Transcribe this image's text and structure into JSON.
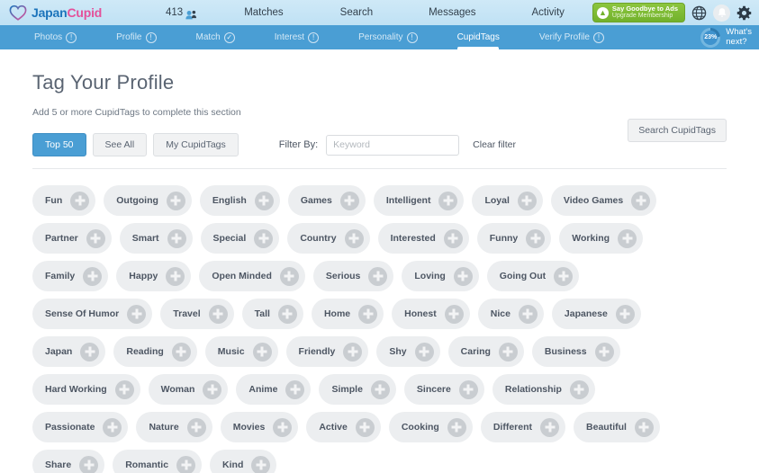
{
  "header": {
    "logo": {
      "part1": "Japan",
      "part2": "Cupid",
      "icon": "heart-icon"
    },
    "visitor_count": "413",
    "nav": [
      {
        "label": "Matches"
      },
      {
        "label": "Search"
      },
      {
        "label": "Messages"
      },
      {
        "label": "Activity"
      }
    ],
    "upgrade": {
      "line1": "Say Goodbye to Ads",
      "line2": "Upgrade Membership",
      "icon": "arrow-up-circle-icon",
      "color": "#8cc63f"
    },
    "icons": {
      "globe": "globe-icon",
      "bell": "bell-icon",
      "gear": "gear-icon"
    }
  },
  "subnav": {
    "items": [
      {
        "label": "Photos",
        "badge": "!",
        "active": false
      },
      {
        "label": "Profile",
        "badge": "!",
        "active": false
      },
      {
        "label": "Match",
        "badge": "✓",
        "active": false
      },
      {
        "label": "Interest",
        "badge": "!",
        "active": false
      },
      {
        "label": "Personality",
        "badge": "!",
        "active": false
      },
      {
        "label": "CupidTags",
        "badge": "",
        "active": true
      },
      {
        "label": "Verify Profile",
        "badge": "!",
        "active": false
      }
    ],
    "progress": {
      "value": "23%",
      "label_line1": "What's",
      "label_line2": "next?"
    },
    "accent": "#4a9ed4"
  },
  "main": {
    "title": "Tag Your Profile",
    "subtitle": "Add 5 or more CupidTags to complete this section",
    "search_button": "Search CupidTags",
    "tabs": [
      {
        "label": "Top 50",
        "active": true
      },
      {
        "label": "See All",
        "active": false
      },
      {
        "label": "My CupidTags",
        "active": false
      }
    ],
    "filter_label": "Filter By:",
    "filter_placeholder": "Keyword",
    "filter_value": "",
    "clear_filter": "Clear filter",
    "tag_rows": [
      [
        "Fun",
        "Outgoing",
        "English",
        "Games",
        "Intelligent",
        "Loyal",
        "Video Games"
      ],
      [
        "Partner",
        "Smart",
        "Special",
        "Country",
        "Interested",
        "Funny",
        "Working"
      ],
      [
        "Family",
        "Happy",
        "Open Minded",
        "Serious",
        "Loving",
        "Going Out"
      ],
      [
        "Sense Of Humor",
        "Travel",
        "Tall",
        "Home",
        "Honest",
        "Nice",
        "Japanese"
      ],
      [
        "Japan",
        "Reading",
        "Music",
        "Friendly",
        "Shy",
        "Caring",
        "Business"
      ],
      [
        "Hard Working",
        "Woman",
        "Anime",
        "Simple",
        "Sincere",
        "Relationship"
      ],
      [
        "Passionate",
        "Nature",
        "Movies",
        "Active",
        "Cooking",
        "Different",
        "Beautiful"
      ],
      [
        "Share",
        "Romantic",
        "Kind"
      ]
    ]
  }
}
